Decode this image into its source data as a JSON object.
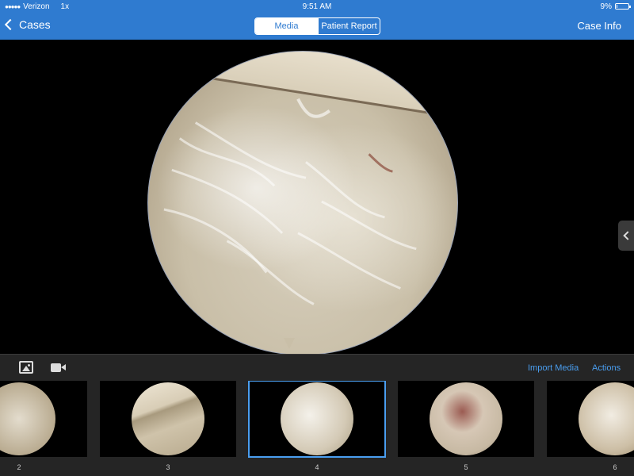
{
  "status_bar": {
    "carrier": "Verizon",
    "network": "1x",
    "time": "9:51 AM",
    "battery": "9%",
    "battery_level": 0.09
  },
  "nav": {
    "back_label": "Cases",
    "segments": [
      {
        "label": "Media",
        "selected": true
      },
      {
        "label": "Patient Report",
        "selected": false
      }
    ],
    "case_info_label": "Case Info"
  },
  "toolbar": {
    "photo_icon": "photo-icon",
    "video_icon": "video-camera-icon",
    "import_label": "Import Media",
    "actions_label": "Actions",
    "accent_color": "#4a9ef0"
  },
  "thumbnails": [
    {
      "label": "2",
      "selected": false
    },
    {
      "label": "3",
      "selected": false
    },
    {
      "label": "4",
      "selected": true
    },
    {
      "label": "5",
      "selected": false
    },
    {
      "label": "6",
      "selected": false
    }
  ],
  "colors": {
    "nav_bar": "#2f7bd0",
    "tray_background": "#252525",
    "viewer_background": "#000000"
  }
}
